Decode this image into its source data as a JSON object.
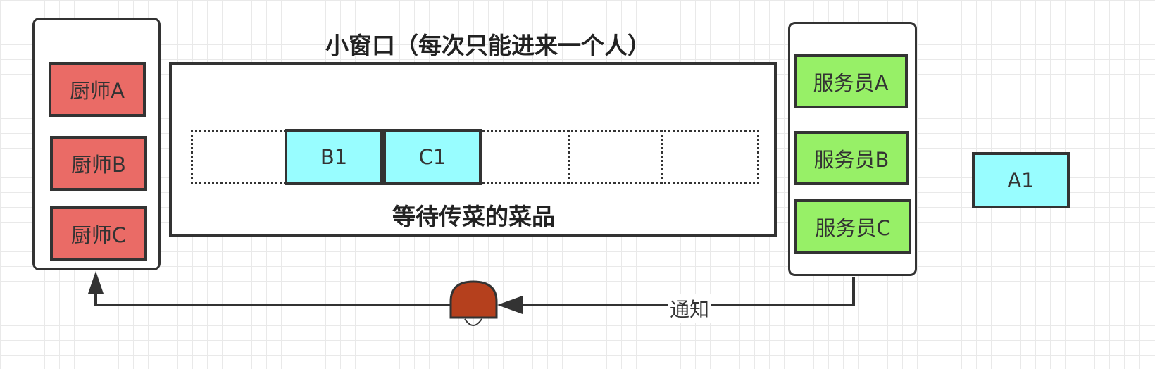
{
  "colors": {
    "chef_fill": "#ea6b66",
    "waiter_fill": "#97f067",
    "dish_fill": "#98fdff",
    "bell_fill": "#b5401d",
    "stroke": "#333333"
  },
  "chefs": {
    "items": [
      {
        "label": "厨师A"
      },
      {
        "label": "厨师B"
      },
      {
        "label": "厨师C"
      }
    ]
  },
  "window": {
    "title": "小窗口（每次只能进来一个人）",
    "queue_label": "等待传菜的菜品",
    "queued_dishes": [
      {
        "label": "B1"
      },
      {
        "label": "C1"
      }
    ]
  },
  "waiters": {
    "items": [
      {
        "label": "服务员A"
      },
      {
        "label": "服务员B"
      },
      {
        "label": "服务员C"
      }
    ]
  },
  "served_dish": {
    "label": "A1"
  },
  "bell": {
    "icon": "bell-icon"
  },
  "notify": {
    "label": "通知"
  }
}
